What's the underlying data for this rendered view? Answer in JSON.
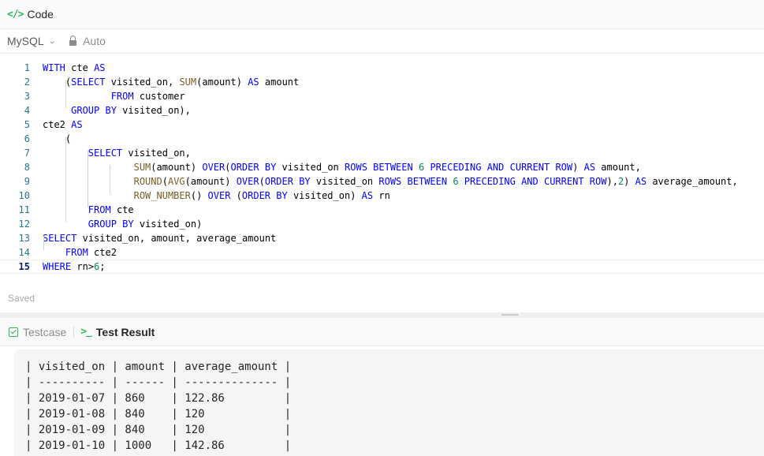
{
  "header": {
    "title": "Code"
  },
  "toolbar": {
    "language": "MySQL",
    "mode": "Auto"
  },
  "editor": {
    "lines": [
      {
        "n": "1"
      },
      {
        "n": "2"
      },
      {
        "n": "3"
      },
      {
        "n": "4"
      },
      {
        "n": "5"
      },
      {
        "n": "6"
      },
      {
        "n": "7"
      },
      {
        "n": "8"
      },
      {
        "n": "9"
      },
      {
        "n": "10"
      },
      {
        "n": "11"
      },
      {
        "n": "12"
      },
      {
        "n": "13"
      },
      {
        "n": "14"
      },
      {
        "n": "15"
      }
    ],
    "code": [
      "WITH cte AS",
      "    (SELECT visited_on, SUM(amount) AS amount",
      "            FROM customer",
      "     GROUP BY visited_on),",
      "cte2 AS",
      "    (",
      "        SELECT visited_on,",
      "                SUM(amount) OVER(ORDER BY visited_on ROWS BETWEEN 6 PRECEDING AND CURRENT ROW) AS amount,",
      "                ROUND(AVG(amount) OVER(ORDER BY visited_on ROWS BETWEEN 6 PRECEDING AND CURRENT ROW),2) AS average_amount,",
      "                ROW_NUMBER() OVER (ORDER BY visited_on) AS rn",
      "        FROM cte",
      "        GROUP BY visited_on)",
      "SELECT visited_on, amount, average_amount",
      "    FROM cte2",
      "WHERE rn>6;"
    ]
  },
  "status": {
    "saved": "Saved"
  },
  "tabs": {
    "testcase": "Testcase",
    "result": "Test Result"
  },
  "result": {
    "lines": [
      "| visited_on | amount | average_amount |",
      "| ---------- | ------ | -------------- |",
      "| 2019-01-07 | 860    | 122.86         |",
      "| 2019-01-08 | 840    | 120            |",
      "| 2019-01-09 | 840    | 120            |",
      "| 2019-01-10 | 1000   | 142.86         |"
    ]
  },
  "colors": {
    "accent": "#2cbb5d",
    "keyword": "#0000ff",
    "function": "#795e26",
    "number": "#098658"
  },
  "icons": {
    "code": "code-brackets-icon",
    "lock": "lock-icon",
    "check": "checkbox-icon",
    "terminal": "terminal-icon"
  }
}
